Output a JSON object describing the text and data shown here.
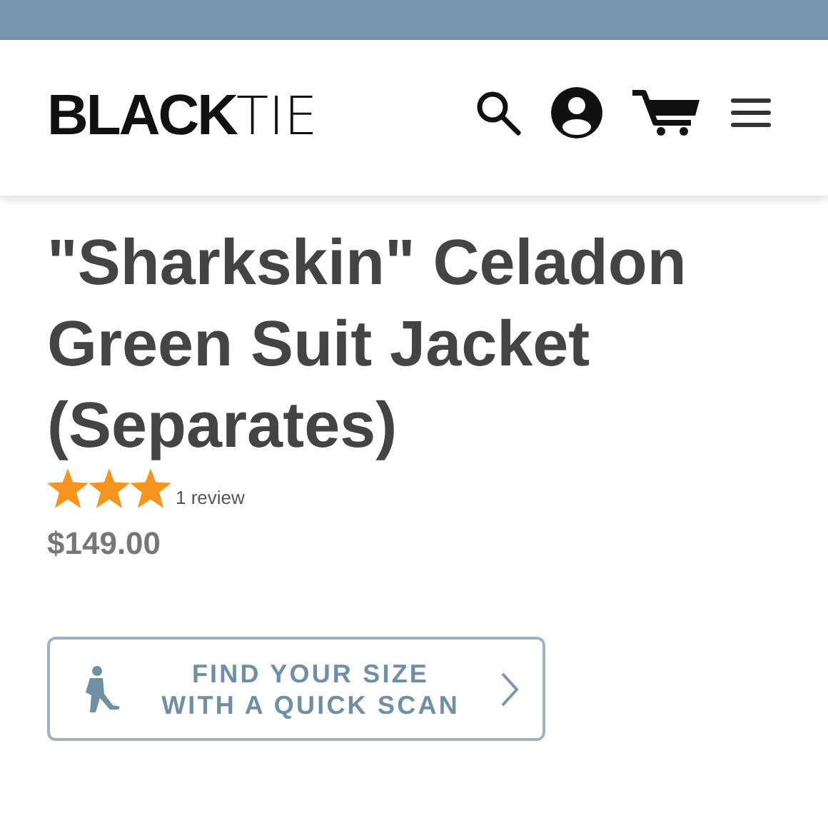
{
  "logo": {
    "bold": "BLACK",
    "light": "TIE"
  },
  "product": {
    "title": "\"Sharkskin\" Celadon Green Suit Jacket (Separates)",
    "stars": 3,
    "reviews": "1 review",
    "price": "$149.00"
  },
  "scan_button": {
    "line1": "FIND YOUR SIZE",
    "line2": "WITH A QUICK SCAN"
  }
}
